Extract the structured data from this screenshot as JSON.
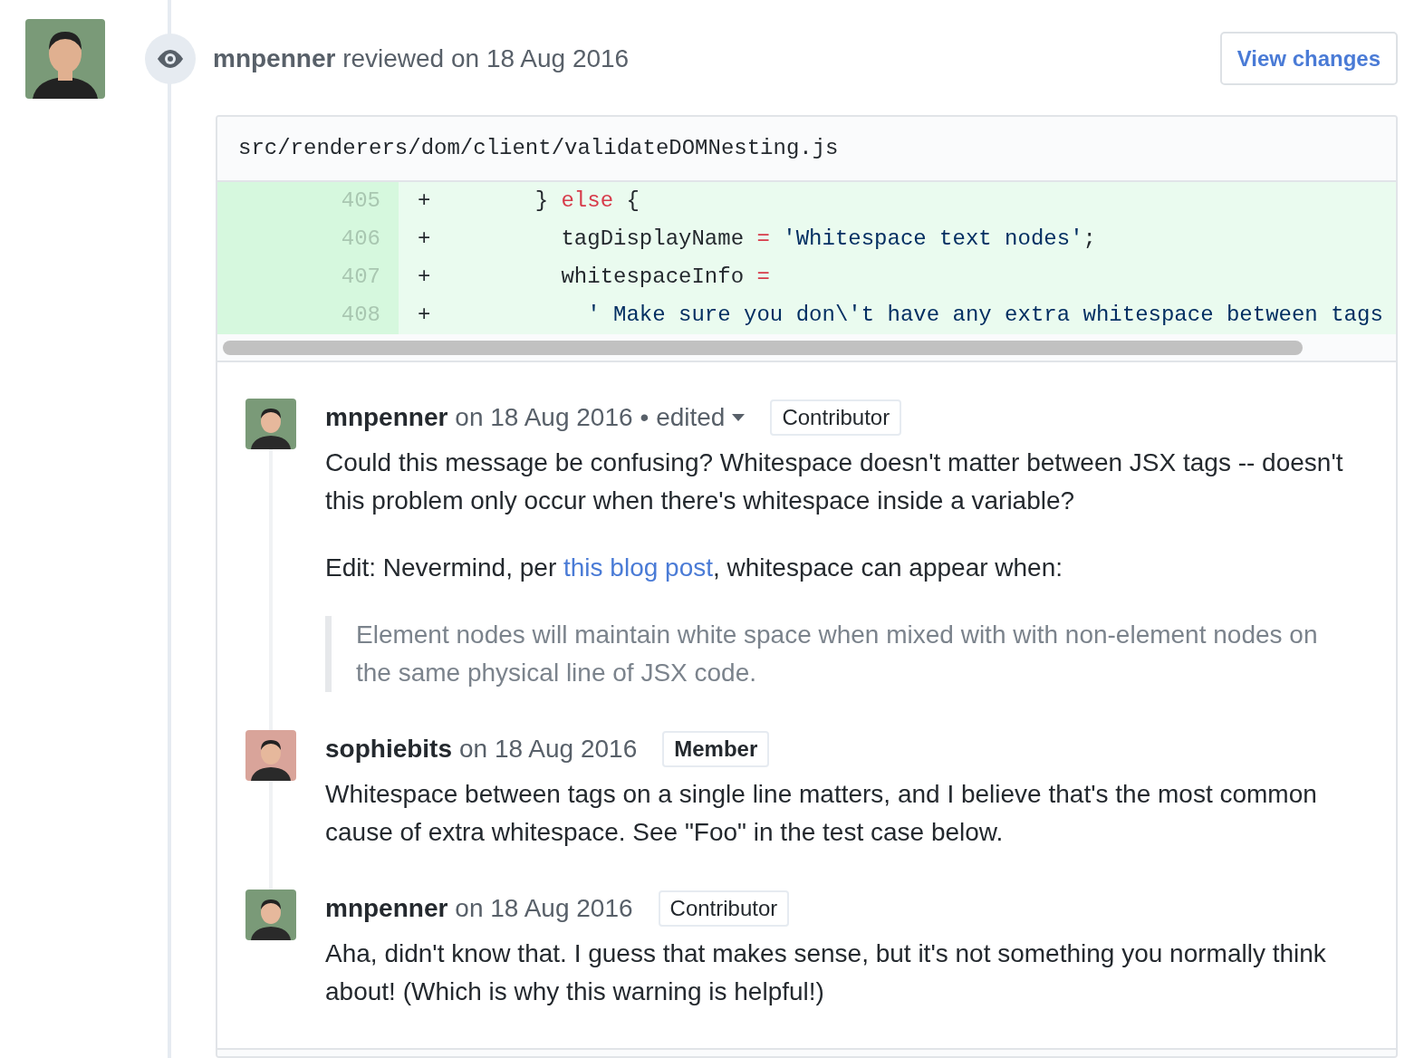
{
  "review": {
    "author": "mnpenner",
    "action": "reviewed on 18 Aug 2016",
    "button": "View changes"
  },
  "file": {
    "path": "src/renderers/dom/client/validateDOMNesting.js",
    "lines": [
      {
        "number": "405",
        "marker": "+",
        "tokens": [
          {
            "kind": "plain",
            "text": "        } "
          },
          {
            "kind": "keyword",
            "text": "else"
          },
          {
            "kind": "plain",
            "text": " {"
          }
        ]
      },
      {
        "number": "406",
        "marker": "+",
        "tokens": [
          {
            "kind": "plain",
            "text": "          tagDisplayName "
          },
          {
            "kind": "keyword",
            "text": "="
          },
          {
            "kind": "string",
            "text": " 'Whitespace text nodes'"
          },
          {
            "kind": "plain",
            "text": ";"
          }
        ]
      },
      {
        "number": "407",
        "marker": "+",
        "tokens": [
          {
            "kind": "plain",
            "text": "          whitespaceInfo "
          },
          {
            "kind": "keyword",
            "text": "="
          }
        ]
      },
      {
        "number": "408",
        "marker": "+",
        "tokens": [
          {
            "kind": "string",
            "text": "            ' Make sure you don\\'t have any extra whitespace between tags"
          }
        ]
      }
    ]
  },
  "comments": [
    {
      "author": "mnpenner",
      "date": "on 18 Aug 2016",
      "edited_label": "• edited",
      "badge": {
        "label": "Contributor",
        "bold": false
      },
      "color": "#7a9a78",
      "body": [
        {
          "kind": "paragraph",
          "text": "Could this message be confusing? Whitespace doesn't matter between JSX tags -- doesn't this problem only occur when there's whitespace inside a variable?"
        },
        {
          "kind": "link_paragraph",
          "before": "Edit: Nevermind, per ",
          "link": "this blog post",
          "after": ", whitespace can appear when:"
        },
        {
          "kind": "quote",
          "text": "Element nodes will maintain white space when mixed with with non-element nodes on the same physical line of JSX code."
        }
      ]
    },
    {
      "author": "sophiebits",
      "date": "on 18 Aug 2016",
      "badge": {
        "label": "Member",
        "bold": true
      },
      "color": "#d9a49a",
      "body": [
        {
          "kind": "paragraph",
          "text": "Whitespace between tags on a single line matters, and I believe that's the most common cause of extra whitespace. See \"Foo\" in the test case below."
        }
      ]
    },
    {
      "author": "mnpenner",
      "date": "on 18 Aug 2016",
      "badge": {
        "label": "Contributor",
        "bold": false
      },
      "color": "#7a9a78",
      "body": [
        {
          "kind": "paragraph",
          "text": "Aha, didn't know that. I guess that makes sense, but it's not something you normally think about! (Which is why this warning is helpful!)"
        }
      ]
    }
  ]
}
